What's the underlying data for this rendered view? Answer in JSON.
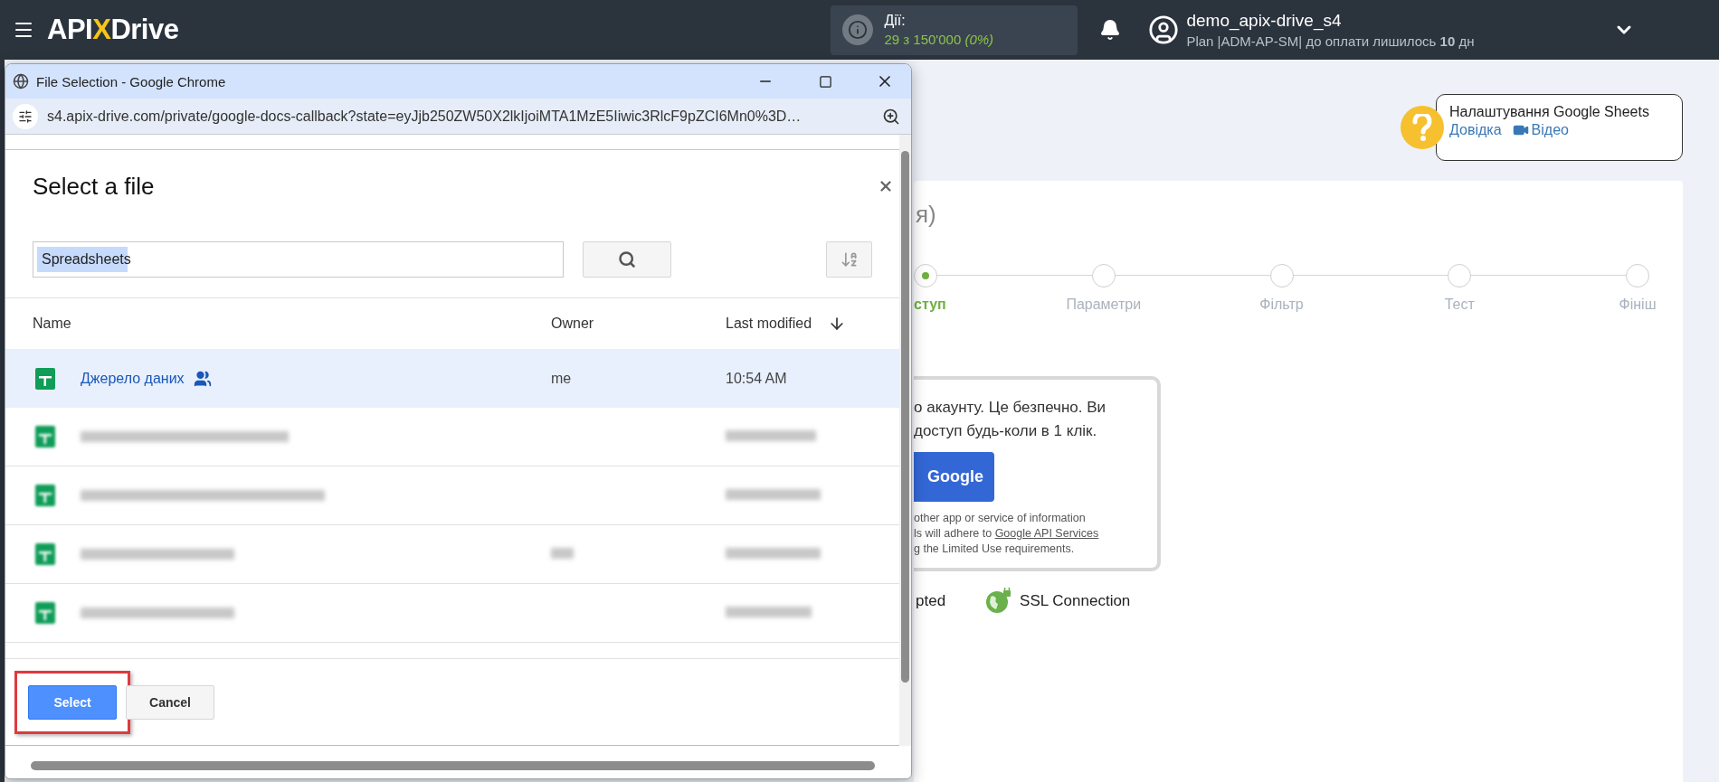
{
  "top_bar": {
    "logo": {
      "left": "API",
      "mark": "X",
      "right": "Drive"
    },
    "actions": {
      "label": "Дії:",
      "value": "29 з 150'000 *(0%)*"
    },
    "user": {
      "name": "demo_apix-drive_s4",
      "plan": "Plan |ADM-AP-SM| до оплати лишилось **10** дн"
    }
  },
  "help": {
    "title": "Налаштування Google Sheets",
    "links": [
      {
        "kind": "doc",
        "label": "Довідка"
      },
      {
        "kind": "video",
        "label": "Відео"
      }
    ]
  },
  "card": {
    "title": "я)",
    "steps": [
      {
        "label": "ступ",
        "selected": true
      },
      {
        "label": "Параметри",
        "selected": false
      },
      {
        "label": "Фільтр",
        "selected": false
      },
      {
        "label": "Тест",
        "selected": false
      },
      {
        "label": "Фініш",
        "selected": false
      }
    ],
    "auth_panel": {
      "lines": [
        "о акаунту. Це безпечно. Ви",
        "доступ будь-коли в 1 клік."
      ],
      "button": "Google",
      "note": {
        "line_1": "other app or service of information",
        "line_2": "ls will adhere to",
        "link": "Google API Services",
        "line_3": "g the Limited Use requirements."
      }
    },
    "badges": [
      {
        "kind": "plain",
        "label": "pted"
      },
      {
        "kind": "ssl",
        "label": "SSL Connection"
      }
    ]
  },
  "popup": {
    "title": "File Selection - Google Chrome",
    "url": "s4.apix-drive.com/private/google-docs-callback?state=eyJjb250ZW50X2lkIjoiMTA1MzE5Iiwic3RlcF9pZCI6Mn0%3D…",
    "dialog": {
      "title": "Select a file",
      "search": {
        "value": "Spreadsheets"
      },
      "columns": [
        "Name",
        "Owner",
        "Last modified"
      ],
      "rows": [
        {
          "kind": "file",
          "name": "Джерело даних",
          "shared": true,
          "owner": "me",
          "modified": "10:54 AM",
          "selected": true
        },
        {
          "kind": "blurred",
          "owner_blurred": false,
          "selected": false
        },
        {
          "kind": "blurred",
          "owner_blurred": false,
          "selected": false
        },
        {
          "kind": "blurred",
          "owner_blurred": true,
          "selected": false
        },
        {
          "kind": "blurred",
          "owner_blurred": false,
          "selected": false
        }
      ],
      "buttons": [
        {
          "kind": "primary",
          "label": "Select",
          "highlighted": true
        },
        {
          "kind": "secondary",
          "label": "Cancel",
          "highlighted": false
        }
      ]
    }
  }
}
